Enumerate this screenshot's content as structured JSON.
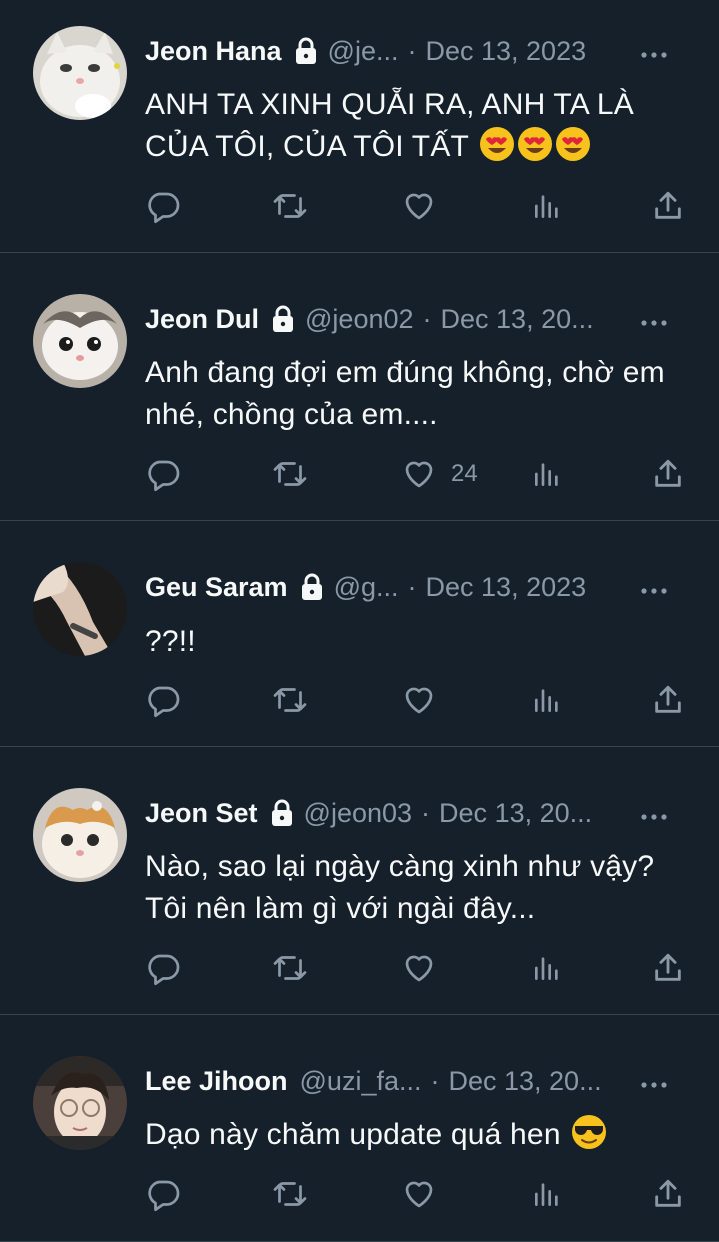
{
  "tweets": [
    {
      "name": "Jeon Hana",
      "handle": "@je...",
      "date": "Dec 13, 2023",
      "text": "ANH TA XINH QUẴI RA, ANH TA LÀ CỦA TÔI, CỦA TÔI TẤT",
      "emoji": "heart-eyes-emoji",
      "emoji_count": 3,
      "likes": "",
      "protected": true,
      "avatar": "white-cat-avatar"
    },
    {
      "name": "Jeon Dul",
      "handle": "@jeon02",
      "date": "Dec 13, 20...",
      "text": "Anh đang đợi em đúng không, chờ em nhé, chồng của em....",
      "emoji": "",
      "emoji_count": 0,
      "likes": "24",
      "protected": true,
      "avatar": "kitten-avatar"
    },
    {
      "name": "Geu Saram",
      "handle": "@g...",
      "date": "Dec 13, 2023",
      "text": "??!!",
      "emoji": "",
      "emoji_count": 0,
      "likes": "",
      "protected": true,
      "avatar": "wrist-avatar"
    },
    {
      "name": "Jeon Set",
      "handle": "@jeon03",
      "date": "Dec 13, 20...",
      "text": "Nào, sao lại ngày càng xinh như vậy? Tôi nên làm gì với ngài đây...",
      "emoji": "",
      "emoji_count": 0,
      "likes": "",
      "protected": true,
      "avatar": "orange-cat-avatar"
    },
    {
      "name": "Lee Jihoon",
      "handle": "@uzi_fa...",
      "date": "Dec 13, 20...",
      "text": "Dạo này chăm update quá hen",
      "emoji": "sunglasses-emoji",
      "emoji_count": 1,
      "likes": "",
      "protected": false,
      "avatar": "person-glasses-avatar"
    }
  ],
  "icons": {
    "reply": "reply-icon",
    "retweet": "retweet-icon",
    "like": "heart-icon",
    "views": "views-icon",
    "share": "share-icon",
    "more": "more-icon",
    "lock": "lock-icon"
  },
  "colors": {
    "background": "#15202b",
    "divider": "#38444d",
    "text": "#f7f9f9",
    "muted": "#8b98a5"
  }
}
